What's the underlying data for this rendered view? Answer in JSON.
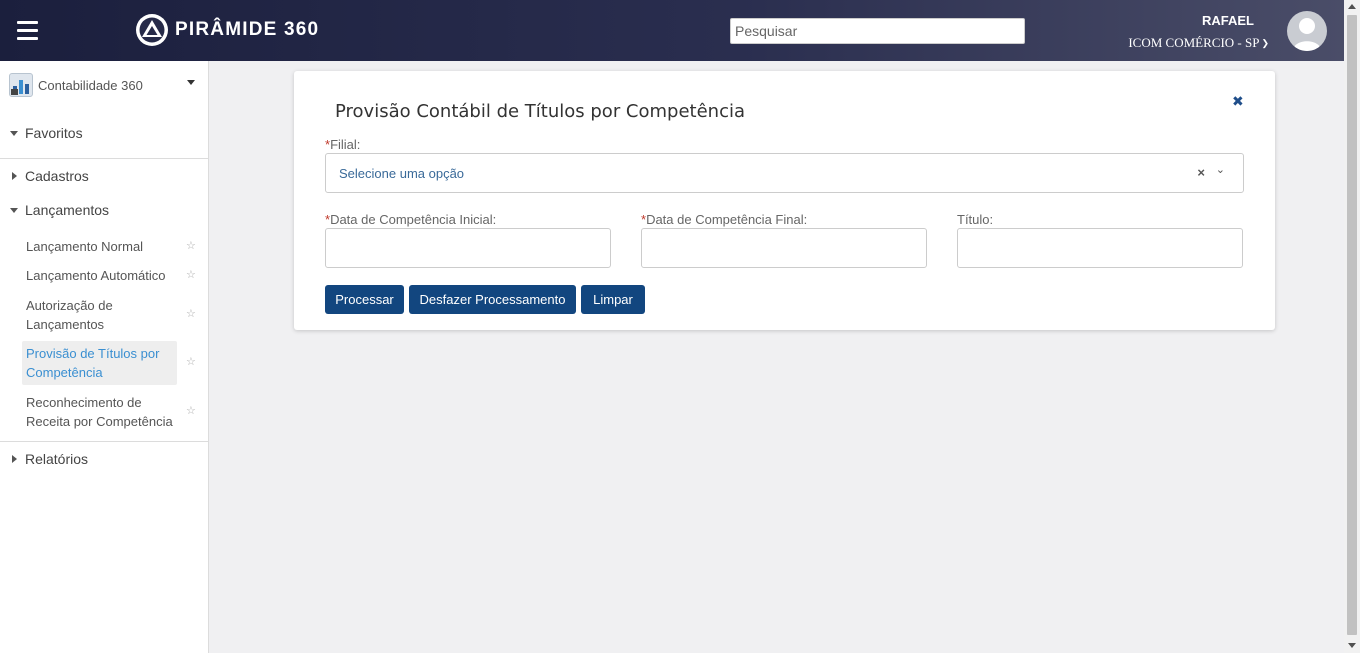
{
  "header": {
    "brand": "PIRÂMIDE 360",
    "search_placeholder": "Pesquisar",
    "user_name": "RAFAEL",
    "company": "ICOM COMÉRCIO - SP"
  },
  "sidebar": {
    "module": "Contabilidade 360",
    "favoritos": "Favoritos",
    "cadastros": "Cadastros",
    "lancamentos": "Lançamentos",
    "items": [
      {
        "label": "Lançamento Normal"
      },
      {
        "label": "Lançamento Automático"
      },
      {
        "label": "Autorização de Lançamentos"
      },
      {
        "label": "Provisão de Títulos por Competência",
        "active": true
      },
      {
        "label": "Reconhecimento de Receita por Competência"
      }
    ],
    "relatorios": "Relatórios"
  },
  "form": {
    "title": "Provisão Contábil de Títulos por Competência",
    "required_mark": "*",
    "filial_label": "Filial:",
    "filial_placeholder": "Selecione uma opção",
    "data_inicial_label": "Data de Competência Inicial:",
    "data_final_label": "Data de Competência Final:",
    "titulo_label": "Título:",
    "data_inicial_value": "",
    "data_final_value": "",
    "titulo_value": "",
    "buttons": {
      "processar": "Processar",
      "desfazer": "Desfazer Processamento",
      "limpar": "Limpar"
    }
  },
  "colors": {
    "header_dark": "#1b1f3d",
    "primary_button": "#12467f",
    "active_link": "#3a8fd1",
    "required": "#c0392b"
  }
}
